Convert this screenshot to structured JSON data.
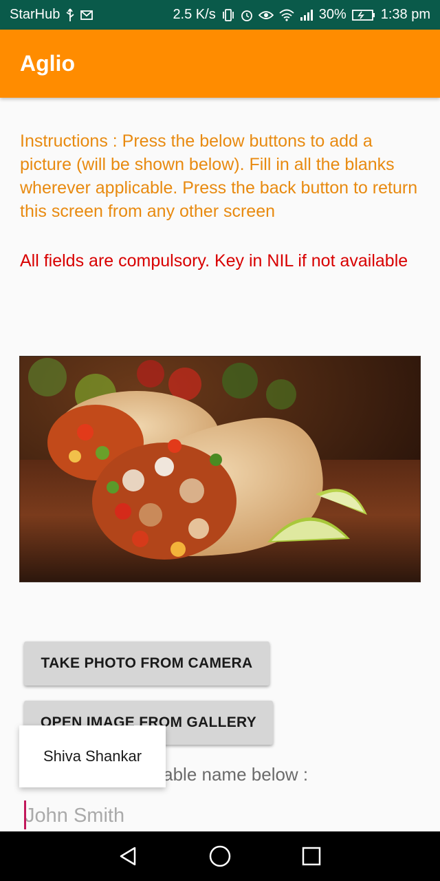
{
  "status_bar": {
    "carrier": "StarHub",
    "speed": "2.5 K/s",
    "battery": "30%",
    "time": "1:38 pm"
  },
  "app_bar": {
    "title": "Aglio"
  },
  "instructions": {
    "text": " Instructions : Press the below buttons to add a picture (will be shown below).   Fill in all the blanks wherever applicable.   Press the back button to return this screen from any other screen",
    "warning": "All fields are compulsory. Key in NIL if not available"
  },
  "buttons": {
    "camera": "TAKE PHOTO FROM CAMERA",
    "gallery": "OPEN IMAGE FROM GALLERY"
  },
  "name_field": {
    "label": "Key in an addressable name below :",
    "placeholder": "John Smith",
    "value": ""
  },
  "autocomplete": {
    "suggestion": "Shiva Shankar"
  },
  "colors": {
    "status_bar": "#0a5a4a",
    "app_bar": "#ff8c00",
    "instructions": "#e88a10",
    "warning": "#d80000"
  }
}
